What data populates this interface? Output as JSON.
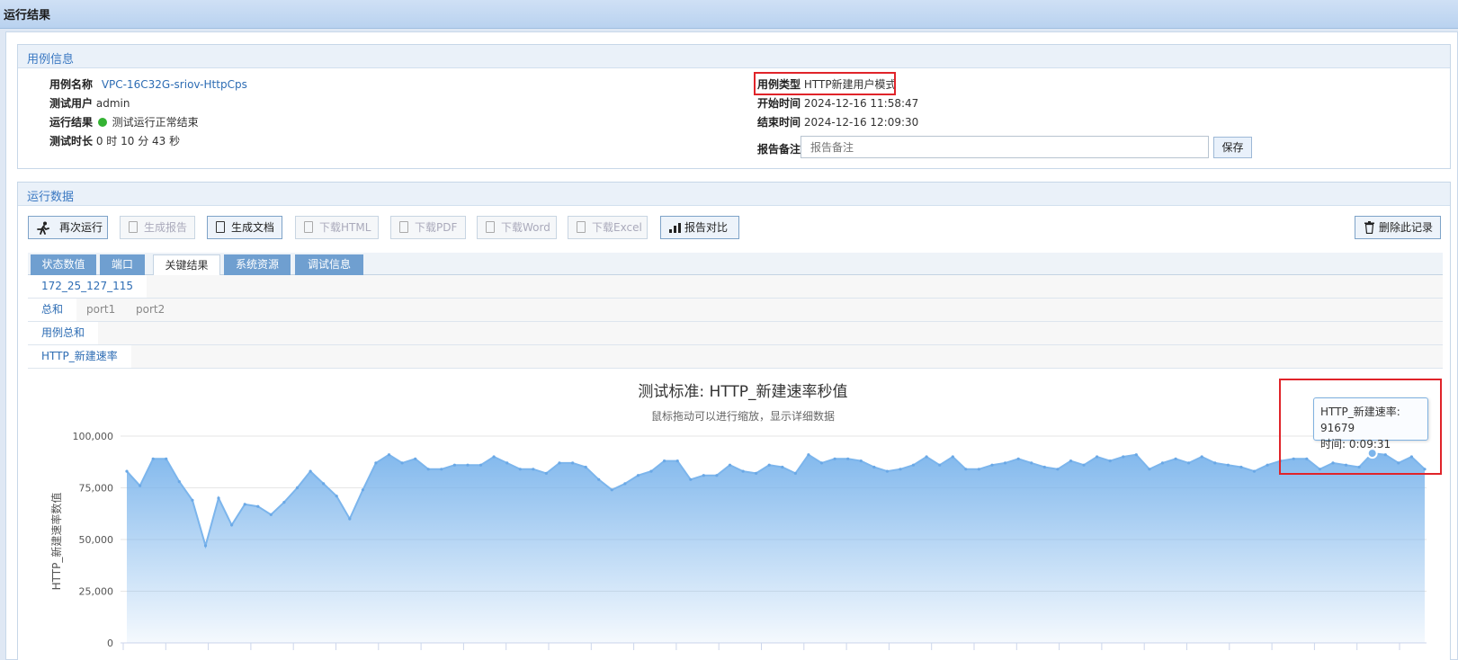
{
  "window": {
    "title": "运行结果"
  },
  "case_info": {
    "header": "用例信息",
    "name_label": "用例名称",
    "name_value": "VPC-16C32G-sriov-HttpCps",
    "user_label": "测试用户",
    "user_value": "admin",
    "result_label": "运行结果",
    "result_value": "测试运行正常结束",
    "duration_label": "测试时长",
    "duration_value": "0 时 10 分 43 秒",
    "type_label": "用例类型",
    "type_value": "HTTP新建用户模式",
    "start_label": "开始时间",
    "start_value": "2024-12-16 11:58:47",
    "end_label": "结束时间",
    "end_value": "2024-12-16 12:09:30",
    "notes_label": "报告备注",
    "notes_placeholder": "报告备注",
    "save_label": "保存"
  },
  "run_data": {
    "header": "运行数据",
    "toolbar": {
      "rerun": "再次运行",
      "gen_report": "生成报告",
      "gen_doc": "生成文档",
      "dl_html": "下载HTML",
      "dl_pdf": "下载PDF",
      "dl_word": "下载Word",
      "dl_excel": "下载Excel",
      "compare": "报告对比",
      "delete": "删除此记录"
    },
    "tabs": [
      "状态数值",
      "端口",
      "关键结果",
      "系统资源",
      "调试信息"
    ],
    "host": "172_25_127_115",
    "ports": [
      "总和",
      "port1",
      "port2"
    ],
    "case_total": "用例总和",
    "metric": "HTTP_新建速率"
  },
  "chart_data": {
    "type": "area",
    "title": "测试标准: HTTP_新建速率秒值",
    "subtitle": "鼠标拖动可以进行缩放，显示详细数据",
    "ylabel": "HTTP_新建速率数值",
    "ylim": [
      0,
      100000
    ],
    "yticks": [
      "100,000",
      "75,000",
      "50,000",
      "25,000",
      "0"
    ],
    "values": [
      83000,
      76000,
      89000,
      89000,
      78000,
      69000,
      47000,
      70000,
      57000,
      67000,
      66000,
      62000,
      68000,
      75000,
      83000,
      77000,
      71000,
      60000,
      74000,
      87000,
      91000,
      87000,
      89000,
      84000,
      84000,
      86000,
      86000,
      86000,
      90000,
      87000,
      84000,
      84000,
      82000,
      87000,
      87000,
      85000,
      79000,
      74000,
      77000,
      81000,
      83000,
      88000,
      88000,
      79000,
      81000,
      81000,
      86000,
      83000,
      82000,
      86000,
      85000,
      82000,
      91000,
      87000,
      89000,
      89000,
      88000,
      85000,
      83000,
      84000,
      86000,
      90000,
      86000,
      90000,
      84000,
      84000,
      86000,
      87000,
      89000,
      87000,
      85000,
      84000,
      88000,
      86000,
      90000,
      88000,
      90000,
      91000,
      84000,
      87000,
      89000,
      87000,
      90000,
      87000,
      86000,
      85000,
      83000,
      86000,
      88000,
      89000,
      89000,
      84000,
      87000,
      86000,
      85000,
      91679,
      91000,
      87000,
      90000,
      84000
    ],
    "color": "#7cb5ec",
    "tooltip": {
      "series_label": "HTTP_新建速率",
      "value": "91679",
      "time_label": "时间",
      "time_value": "0:09:31"
    }
  },
  "colors": {
    "accent": "#3a78c2",
    "highlight": "#e0242a",
    "tab": "#6f9fd0"
  }
}
